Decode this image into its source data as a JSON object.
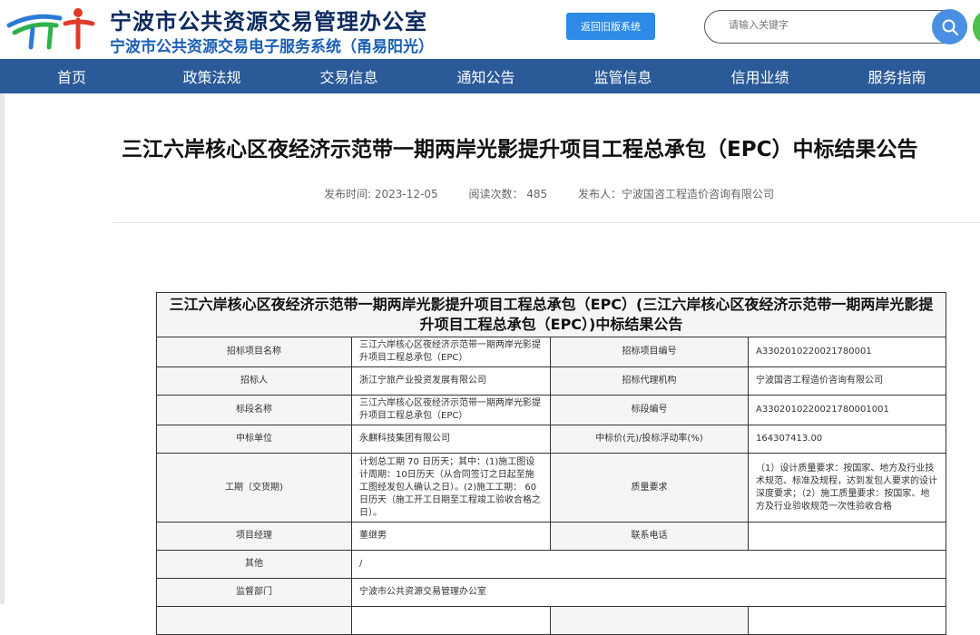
{
  "header": {
    "title": "宁波市公共资源交易管理办公室",
    "subtitle": "宁波市公共资源交易电子服务系统（甬易阳光）",
    "old_system_button": "返回旧版系统",
    "search_placeholder": "请输入关键字",
    "icons": [
      "logo",
      "search-icon"
    ]
  },
  "nav": {
    "items": [
      "首页",
      "政策法规",
      "交易信息",
      "通知公告",
      "监管信息",
      "信用业绩",
      "服务指南"
    ]
  },
  "article": {
    "title": "三江六岸核心区夜经济示范带一期两岸光影提升项目工程总承包（EPC）中标结果公告",
    "publish_time": "发布时间:   2023-12-05",
    "read_count": "阅读次数：  485",
    "publisher": "发布人：宁波国咨工程造价咨询有限公司"
  },
  "table": {
    "caption": "三江六岸核心区夜经济示范带一期两岸光影提升项目工程总承包（EPC）(三江六岸核心区夜经济示范带一期两岸光影提升项目工程总承包（EPC）)中标结果公告",
    "rows": [
      {
        "l1": "招标项目名称",
        "v1": "三江六岸核心区夜经济示范带一期两岸光影提升项目工程总承包（EPC）",
        "l2": "招标项目编号",
        "v2": "A3302010220021780001"
      },
      {
        "l1": "招标人",
        "v1": "浙江宁旅产业投资发展有限公司",
        "l2": "招标代理机构",
        "v2": "宁波国咨工程造价咨询有限公司"
      },
      {
        "l1": "标段名称",
        "v1": "三江六岸核心区夜经济示范带一期两岸光影提升项目工程总承包（EPC）",
        "l2": "标段编号",
        "v2": "A3302010220021780001001"
      },
      {
        "l1": "中标单位",
        "v1": "永麒科技集团有限公司",
        "l2": "中标价(元)/投标浮动率(%)",
        "v2": "164307413.00"
      },
      {
        "l1": "工期（交货期)",
        "v1": "计划总工期 70 日历天；其中：(1)施工图设计周期：10日历天（从合同签订之日起至施工图经发包人确认之日）。(2)施工工期： 60日历天（施工开工日期至工程竣工验收合格之日）。",
        "l2": "质量要求",
        "v2": "（1）设计质量要求：按国家、地方及行业技术规范、标准及规程，达到发包人要求的设计深度要求；（2）施工质量要求：按国家、地方及行业验收规范一次性验收合格"
      },
      {
        "l1": "项目经理",
        "v1": "董继男",
        "l2": "联系电话",
        "v2": ""
      }
    ],
    "other_label": "其他",
    "other_value": "/",
    "supervisor_label": "监督部门",
    "supervisor_value": "宁波市公共资源交易管理办公室"
  }
}
